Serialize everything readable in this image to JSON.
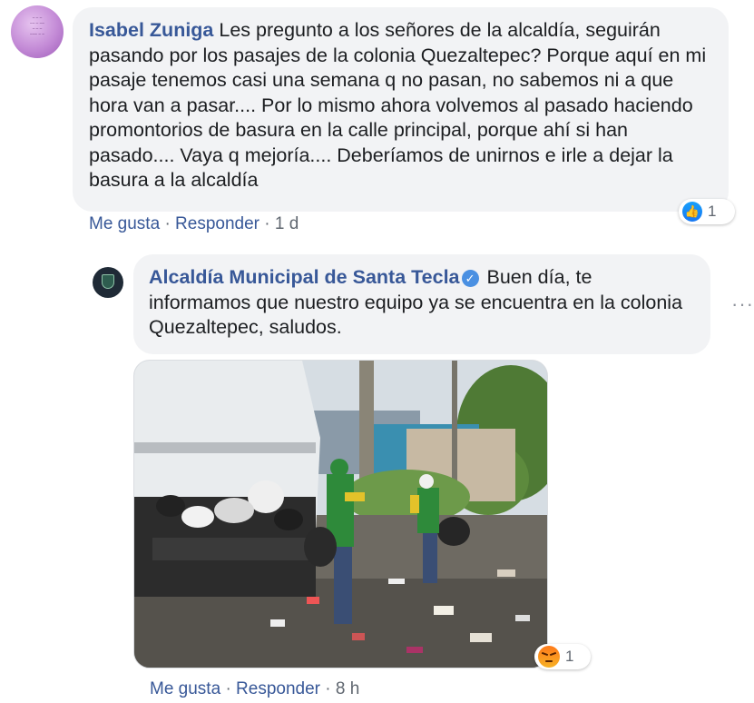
{
  "comment": {
    "author": "Isabel Zuniga",
    "text": "Les pregunto a los señores de la alcaldía, seguirán pasando por los pasajes de la colonia Quezaltepec? Porque aquí en mi pasaje tenemos casi una semana q no pasan, no sabemos ni a que hora van a pasar.... Por lo mismo ahora volvemos al pasado haciendo promontorios de basura en la calle principal, porque ahí si han pasado.... Vaya q mejoría.... Deberíamos de unirnos e irle a dejar la basura a la alcaldía",
    "reaction_count": "1",
    "reaction_icon": "like-icon",
    "like_label": "Me gusta",
    "reply_label": "Responder",
    "separator": "·",
    "time": "1 d"
  },
  "reply": {
    "author": "Alcaldía Municipal de Santa Tecla",
    "verified_icon": "verified-badge-icon",
    "text": "Buen día, te informamos que nuestro equipo ya se encuentra en la colonia Quezaltepec, saludos.",
    "reaction_count": "1",
    "reaction_icon": "angry-icon",
    "like_label": "Me gusta",
    "reply_label": "Responder",
    "separator": "·",
    "time": "8 h",
    "more_label": "···"
  },
  "colors": {
    "bubble": "#f2f3f5",
    "author": "#385898",
    "like_blue": "#1877f2",
    "muted": "#606770"
  }
}
